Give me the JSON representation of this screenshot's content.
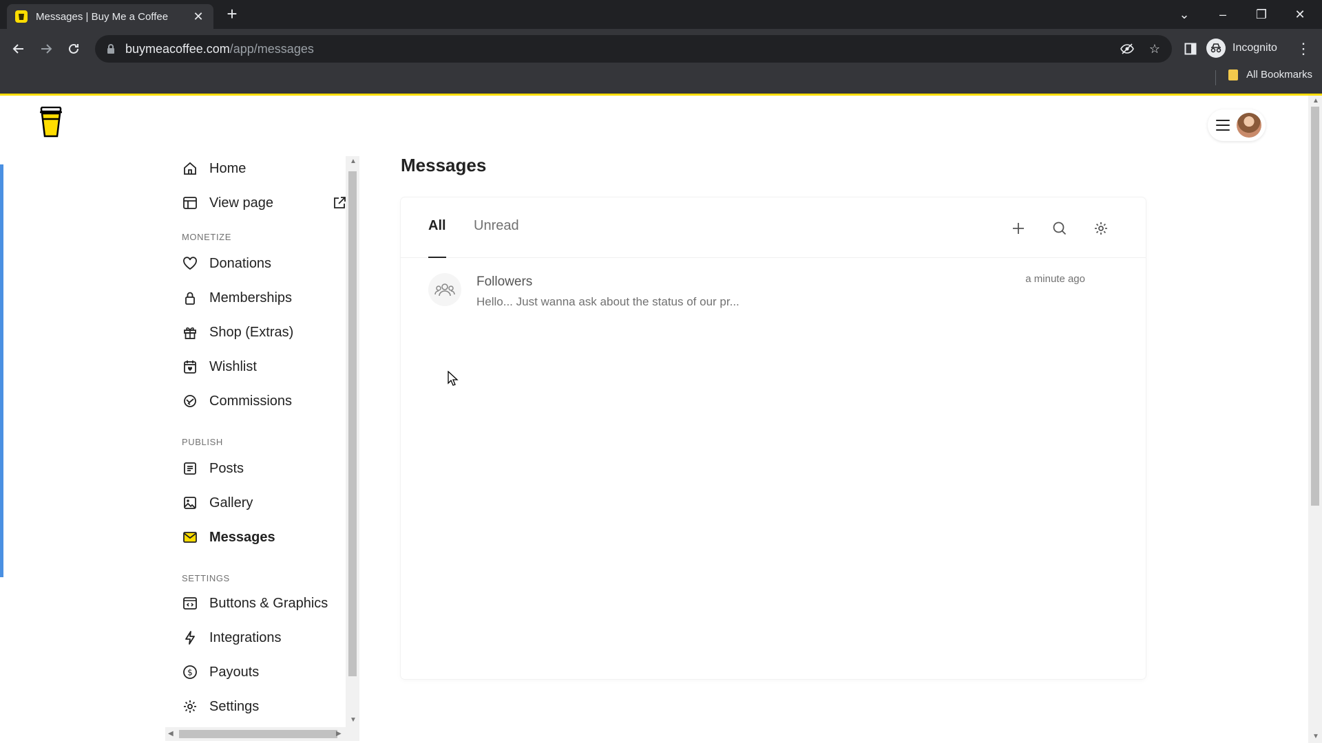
{
  "browser": {
    "tab_title": "Messages | Buy Me a Coffee",
    "url_host": "buymeacoffee.com",
    "url_path": "/app/messages",
    "profile_label": "Incognito",
    "bookmarks_label": "All Bookmarks"
  },
  "sidebar": {
    "home": "Home",
    "view_page": "View page",
    "section_monetize": "MONETIZE",
    "donations": "Donations",
    "memberships": "Memberships",
    "shop": "Shop (Extras)",
    "wishlist": "Wishlist",
    "commissions": "Commissions",
    "section_publish": "PUBLISH",
    "posts": "Posts",
    "gallery": "Gallery",
    "messages": "Messages",
    "section_settings": "SETTINGS",
    "buttons_graphics": "Buttons & Graphics",
    "integrations": "Integrations",
    "payouts": "Payouts",
    "settings": "Settings"
  },
  "main": {
    "title": "Messages",
    "tabs": [
      {
        "label": "All",
        "active": true
      },
      {
        "label": "Unread",
        "active": false
      }
    ],
    "conversations": [
      {
        "name": "Followers",
        "preview": "Hello... Just wanna ask about the status of our pr...",
        "time": "a minute ago"
      }
    ]
  },
  "colors": {
    "brand_yellow": "#ffdd00",
    "accent_blue": "#4a90e2"
  }
}
